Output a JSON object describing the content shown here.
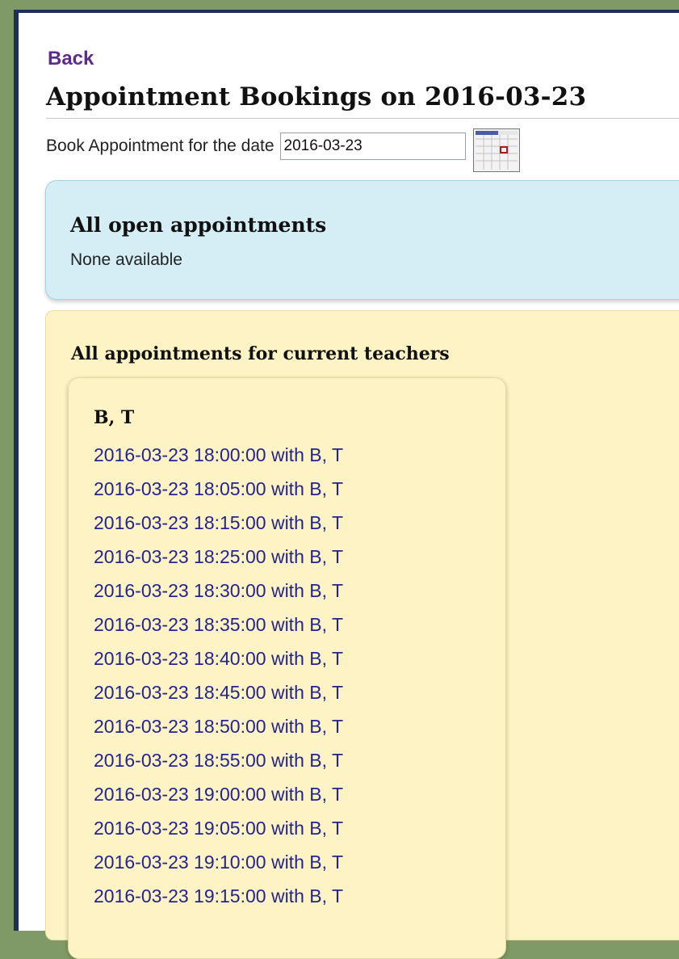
{
  "nav": {
    "back_label": "Back"
  },
  "page": {
    "title": "Appointment Bookings on 2016-03-23"
  },
  "booking": {
    "label": "Book Appointment for the date",
    "date_value": "2016-03-23"
  },
  "open_appointments": {
    "heading": "All open appointments",
    "status_text": "None available"
  },
  "teacher_appointments": {
    "heading": "All appointments for current teachers",
    "teachers": [
      {
        "name": "B, T",
        "slots": [
          "2016-03-23 18:00:00 with B, T",
          "2016-03-23 18:05:00 with B, T",
          "2016-03-23 18:15:00 with B, T",
          "2016-03-23 18:25:00 with B, T",
          "2016-03-23 18:30:00 with B, T",
          "2016-03-23 18:35:00 with B, T",
          "2016-03-23 18:40:00 with B, T",
          "2016-03-23 18:45:00 with B, T",
          "2016-03-23 18:50:00 with B, T",
          "2016-03-23 18:55:00 with B, T",
          "2016-03-23 19:00:00 with B, T",
          "2016-03-23 19:05:00 with B, T",
          "2016-03-23 19:10:00 with B, T",
          "2016-03-23 19:15:00 with B, T"
        ]
      }
    ]
  },
  "icons": {
    "calendar": "calendar-icon"
  },
  "colors": {
    "link": "#24248f",
    "back_link": "#5c2b8e",
    "open_panel": "#d5eef6",
    "teacher_panel": "#fdf3c4",
    "window_frame": "#1f2f58",
    "outer_background": "#7f9a66"
  }
}
